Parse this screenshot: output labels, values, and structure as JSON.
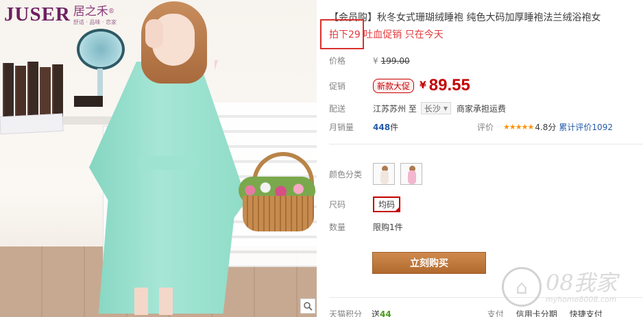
{
  "brand": {
    "name": "JUSER",
    "cn_name": "居之禾",
    "reg_mark": "®",
    "tagline": "舒适 · 品味 · 恋家"
  },
  "product": {
    "title": "【会员购】秋冬女式珊瑚绒睡袍 纯色大码加厚睡袍法兰绒浴袍女",
    "subtitle": "拍下29 吐血促销 只在今天"
  },
  "price": {
    "label": "价格",
    "currency": "¥",
    "original": "199.00"
  },
  "promo": {
    "label": "促销",
    "tag": "新款大促",
    "currency": "¥",
    "price": "89.55"
  },
  "shipping": {
    "label": "配送",
    "from": "江苏苏州 至",
    "city": "长沙",
    "note": "商家承担运费"
  },
  "sales": {
    "label": "月销量",
    "count": "448",
    "unit": "件",
    "rating_label": "评价",
    "stars": "★★★★★",
    "score": "4.8分",
    "review_text": "累计评价1092"
  },
  "options": {
    "color_label": "颜色分类",
    "size_label": "尺码",
    "size_value": "均码",
    "qty_label": "数量",
    "qty_limit": "限购1件"
  },
  "buy_button": "立刻购买",
  "bottom": {
    "points_label": "天猫积分",
    "points_prefix": "送",
    "points_value": "44",
    "pay_label": "支付",
    "pay_credit": "信用卡分期",
    "pay_fast": "快捷支付"
  },
  "watermark": {
    "big": "08我家",
    "url": "myhome8008.com"
  },
  "colors": {
    "price_red": "#c40000",
    "title_red": "#e4393c",
    "buy_button": "#b26a2e",
    "link_blue": "#245ba8",
    "star_orange": "#ff9300"
  }
}
